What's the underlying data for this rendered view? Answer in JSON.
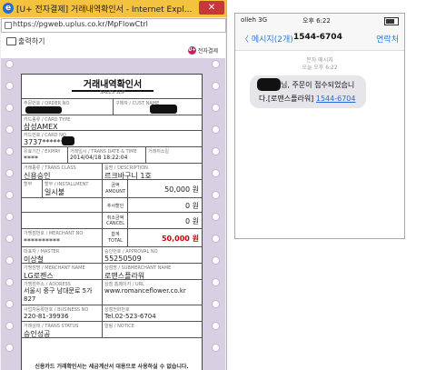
{
  "browser": {
    "title": "[U+ 전자결제] 거래내역확인서 - Internet Expl...",
    "logo_glyph": "e",
    "close_glyph": "✕",
    "url": "https://pgweb.uplus.co.kr/MpFlowCtrl"
  },
  "page": {
    "print_label": "출력하기",
    "lg_logo_glyph": "U+",
    "lg_logo_text": "전자결제"
  },
  "receipt": {
    "title": "거래내역확인서",
    "subtitle": "SALES SLIP",
    "labels": {
      "member": "주문번호 / ORDER NO",
      "customer": "구매자 / CUST NAME",
      "card_type": "카드종류 / CARD TYPE",
      "card_no": "카드번호 / CARD NO",
      "expiry": "유효기간 / EXPIRY",
      "trans_date": "거래일시 / TRANS DATE & TIME",
      "cancel_date": "거래취소일",
      "trans_class": "거래종류 / TRANS CLASS",
      "description": "품명 / DESCRIPTION",
      "installment_h": "할부",
      "installment": "할부 / INSTALLMENT",
      "amount": "금액",
      "amount_en": "AMOUNT",
      "surcharge": "추서할인",
      "cancel": "취소금액",
      "cancel_en": "CANCEL",
      "merchant_no": "가맹점번호 / MERCHANT NO",
      "total": "합계",
      "total_en": "TOTAL",
      "master": "대표자 / MASTER",
      "approval": "승인번호 / APPROVAL NO",
      "merchant_name": "가맹점명 / MERCHANT NAME",
      "sub_merchant": "상점명 / SUBMERCHANT NAME",
      "address": "가맹점주소 / ADDRESS",
      "url": "상점 홈페이지 / URL",
      "business_no": "사업자등록번호 / BUSINESS NO",
      "tel": "상점전화번호",
      "trans_status": "거래상태 / TRANS STATUS",
      "notice": "알림 / NOTICE"
    },
    "values": {
      "card_type": "삼성AMEX",
      "card_no": "3737******",
      "expiry": "****",
      "trans_date": "2014/04/18 18:22:04",
      "trans_class": "신용승인",
      "description": "르크바구니 1호",
      "installment": "일시불",
      "amount": "50,000 원",
      "surcharge": "0 원",
      "cancel": "0 원",
      "merchant_no": "**********",
      "total": "50,000 원",
      "master": "이상철",
      "approval": "55250509",
      "merchant_name": "LG로젠스",
      "sub_merchant": "로맨스플라워",
      "address": "서울시 중구 남대문로 5가 827",
      "url": "www.romanceflower.co.kr",
      "business_no": "220-81-39936",
      "tel": "Tel.02-523-6704",
      "trans_status": "승인성공"
    },
    "footer": "신용카드 거래확인서는 세금계산서 대용으로 사용하실 수 없습니다."
  },
  "phone": {
    "carrier": "olleh 3G",
    "time": "오후 6:22",
    "back_label": "〈 메시지(2개)",
    "title": "1544-6704",
    "contact_label": "연락처",
    "message_kind": "문자 메시지",
    "message_time": "오늘 오후 6:22",
    "message_line1": "님, 주문이 접수되었습니",
    "message_line2_prefix": "다.[로맨스플라워] ",
    "message_link": "1544-6704"
  }
}
